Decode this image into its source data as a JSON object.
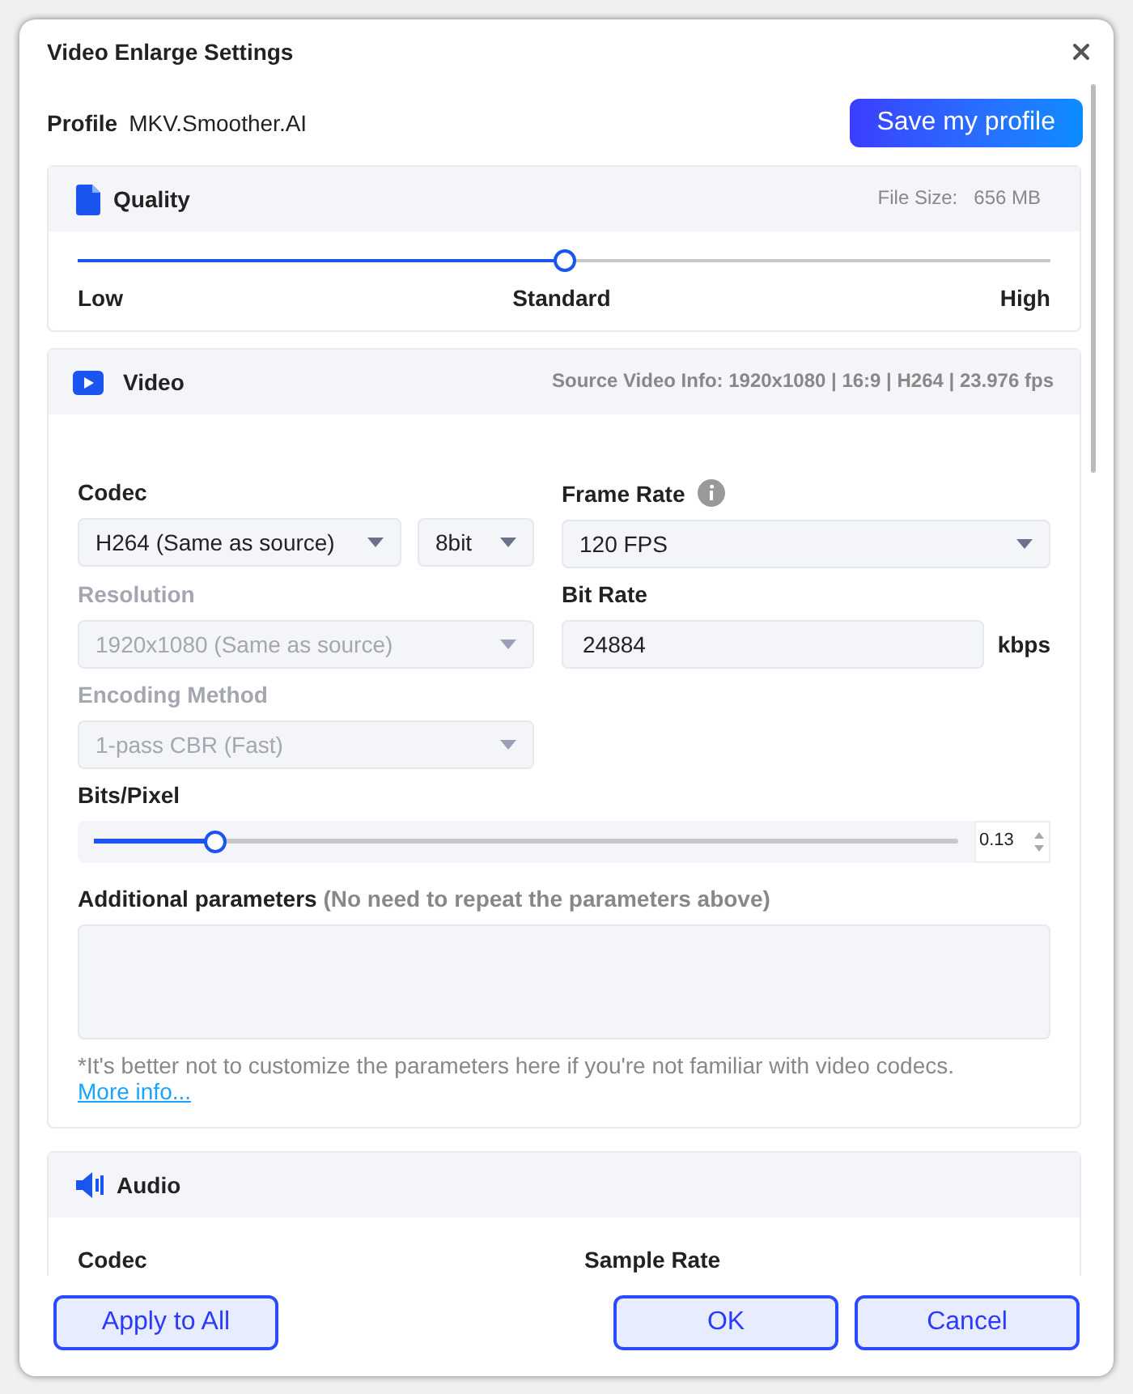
{
  "window": {
    "title": "Video Enlarge Settings"
  },
  "profile": {
    "label": "Profile",
    "value": "MKV.Smoother.AI",
    "save_button": "Save my profile"
  },
  "quality": {
    "title": "Quality",
    "file_size_label": "File Size:",
    "file_size": "656 MB",
    "level": 0.5,
    "marks": [
      "Low",
      "Standard",
      "High"
    ]
  },
  "video": {
    "title": "Video",
    "source_info": "Source Video Info: 1920x1080 | 16:9 | H264 | 23.976 fps",
    "codec": {
      "label": "Codec",
      "value": "H264 (Same as source)",
      "depth": "8bit"
    },
    "frame_rate": {
      "label": "Frame Rate",
      "value": "120 FPS"
    },
    "resolution": {
      "label": "Resolution",
      "value": "1920x1080 (Same as source)",
      "disabled": true
    },
    "bit_rate": {
      "label": "Bit Rate",
      "value": "24884",
      "unit": "kbps"
    },
    "encoding_method": {
      "label": "Encoding Method",
      "value": "1-pass CBR (Fast)",
      "disabled": true
    },
    "bits_per_pixel": {
      "label": "Bits/Pixel",
      "level": 0.14,
      "value": "0.13"
    },
    "additional": {
      "label": "Additional parameters",
      "hint": "(No need to repeat the parameters above)"
    },
    "note": "*It's better not to customize the parameters here if you're not familiar with video codecs.",
    "link": "More info..."
  },
  "audio": {
    "title": "Audio",
    "columns": [
      "Codec",
      "Sample Rate"
    ]
  },
  "buttons": [
    "Apply to All",
    "OK",
    "Cancel"
  ]
}
